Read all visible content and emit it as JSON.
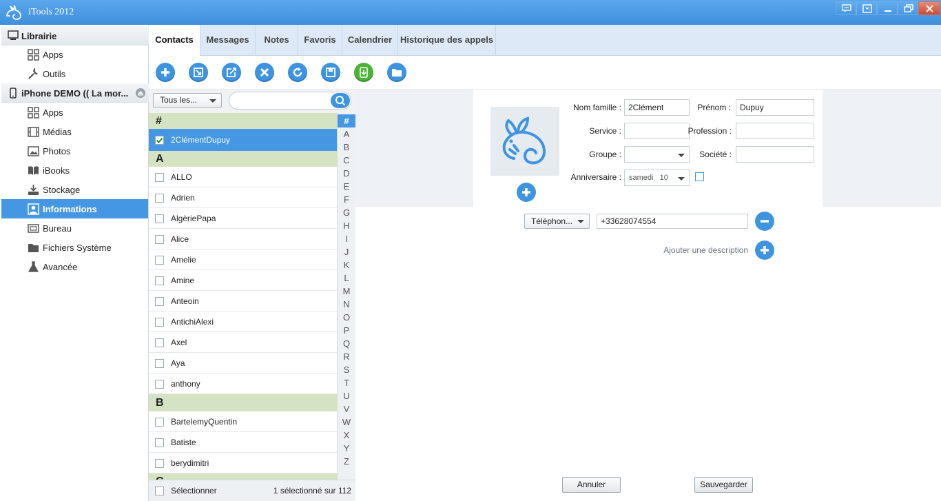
{
  "app": {
    "title": "iTools 2012",
    "logo_icon": "rabbit-logo-icon"
  },
  "window_controls": [
    "feedback-icon",
    "menu-icon",
    "minimize-icon",
    "restore-icon",
    "close-icon"
  ],
  "sidebar": {
    "library": {
      "label": "Librairie",
      "icon": "monitor-icon",
      "items": [
        {
          "label": "Apps",
          "icon": "grid-icon"
        },
        {
          "label": "Outils",
          "icon": "wrench-icon"
        }
      ]
    },
    "device": {
      "label": "iPhone DEMO (( La mor...",
      "icon": "phone-icon",
      "items": [
        {
          "label": "Apps",
          "icon": "grid-icon"
        },
        {
          "label": "Médias",
          "icon": "film-icon"
        },
        {
          "label": "Photos",
          "icon": "photo-icon"
        },
        {
          "label": "iBooks",
          "icon": "book-icon"
        },
        {
          "label": "Stockage",
          "icon": "storage-icon"
        },
        {
          "label": "Informations",
          "icon": "contact-icon"
        },
        {
          "label": "Bureau",
          "icon": "desktop-icon"
        },
        {
          "label": "Fichiers Système",
          "icon": "folder-icon"
        },
        {
          "label": "Avancée",
          "icon": "flask-icon"
        }
      ]
    }
  },
  "tabs": [
    "Contacts",
    "Messages",
    "Notes",
    "Favoris",
    "Calendrier",
    "Historique des appels"
  ],
  "toolbar_icons": [
    "add-icon",
    "import-icon",
    "edit-icon",
    "delete-icon",
    "refresh-icon",
    "save-icon",
    "sync-device-icon",
    "open-folder-icon"
  ],
  "filter": {
    "selected": "Tous les...",
    "search_placeholder": ""
  },
  "contacts": {
    "sections": [
      {
        "letter": "#",
        "names": [
          "2ClémentDupuy"
        ]
      },
      {
        "letter": "A",
        "names": [
          "ALLO",
          "Adrien",
          "AlgèriePapa",
          "Alice",
          "Amelie",
          "Amine",
          "Anteoin",
          "AntichiAlexi",
          "Axel",
          "Aya",
          "anthony"
        ]
      },
      {
        "letter": "B",
        "names": [
          "BartelemyQuentin",
          "Batiste",
          "berydimitri"
        ]
      },
      {
        "letter": "C",
        "names": []
      }
    ],
    "selected": "2ClémentDupuy",
    "alphabet": [
      "#",
      "A",
      "B",
      "C",
      "D",
      "E",
      "F",
      "G",
      "H",
      "I",
      "J",
      "K",
      "L",
      "M",
      "N",
      "O",
      "P",
      "Q",
      "R",
      "S",
      "T",
      "U",
      "V",
      "W",
      "X",
      "Y",
      "Z"
    ],
    "alphabet_active": "#"
  },
  "footer": {
    "select_label": "Sélectionner",
    "count": "1 sélectionné sur 112"
  },
  "form": {
    "nom_label": "Nom famille :",
    "nom_value": "2Clément",
    "prenom_label": "Prénom :",
    "prenom_value": "Dupuy",
    "service_label": "Service :",
    "service_value": "",
    "profession_label": "Profession :",
    "profession_value": "",
    "groupe_label": "Groupe :",
    "groupe_value": "",
    "societe_label": "Société :",
    "societe_value": "",
    "anniv_label": "Anniversaire :",
    "anniv_day": "samedi",
    "anniv_date": "10",
    "phone_type": "Téléphon...",
    "phone_value": "+33628074554",
    "add_description": "Ajouter une description"
  },
  "buttons": {
    "cancel": "Annuler",
    "save": "Sauvegarder"
  },
  "colors": {
    "accent": "#4597e3",
    "section": "#d4e3c2",
    "titlebar": "#4a97e2"
  }
}
